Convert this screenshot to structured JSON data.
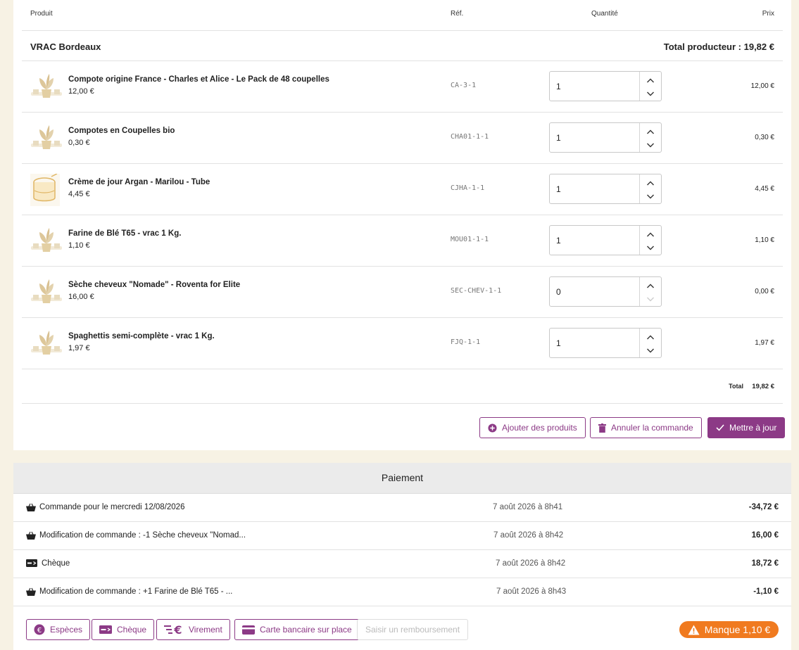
{
  "table": {
    "headers": {
      "product": "Produit",
      "ref": "Réf.",
      "qty": "Quantité",
      "price": "Prix"
    },
    "producer": {
      "name": "VRAC Bordeaux",
      "total": "Total producteur : 19,82 €"
    },
    "rows": [
      {
        "name": "Compote origine France - Charles et Alice - Le Pack de 48 coupelles",
        "unit_price": "12,00 €",
        "ref": "CA-3-1",
        "qty": "1",
        "line_price": "12,00 €",
        "thumb": "plant-icon"
      },
      {
        "name": "Compotes en Coupelles bio",
        "unit_price": "0,30 €",
        "ref": "CHA01-1-1",
        "qty": "1",
        "line_price": "0,30 €",
        "thumb": "plant-icon"
      },
      {
        "name": "Crème de jour Argan - Marilou - Tube",
        "unit_price": "4,45 €",
        "ref": "CJHA-1-1",
        "qty": "1",
        "line_price": "4,45 €",
        "thumb": "jar-icon"
      },
      {
        "name": "Farine de Blé T65 - vrac 1 Kg.",
        "unit_price": "1,10 €",
        "ref": "MOU01-1-1",
        "qty": "1",
        "line_price": "1,10 €",
        "thumb": "plant-icon"
      },
      {
        "name": "Sèche cheveux \"Nomade\" - Roventa for Elite",
        "unit_price": "16,00 €",
        "ref": "SEC-CHEV-1-1",
        "qty": "0",
        "line_price": "0,00 €",
        "thumb": "plant-icon"
      },
      {
        "name": "Spaghettis semi-complète - vrac 1 Kg.",
        "unit_price": "1,97 €",
        "ref": "FJQ-1-1",
        "qty": "1",
        "line_price": "1,97 €",
        "thumb": "plant-icon"
      }
    ],
    "total_label": "Total",
    "total_value": "19,82 €"
  },
  "actions": {
    "add_products": "Ajouter des produits",
    "cancel_order": "Annuler la commande",
    "update": "Mettre à jour"
  },
  "payment": {
    "title": "Paiement",
    "rows": [
      {
        "icon": "basket-icon",
        "label": "Commande pour le mercredi 12/08/2026",
        "date": "7 août 2026 à 8h41",
        "amount": "-34,72 €"
      },
      {
        "icon": "basket-icon",
        "label": "Modification de commande : -1 Sèche cheveux \"Nomad...",
        "date": "7 août 2026 à 8h42",
        "amount": "16,00 €"
      },
      {
        "icon": "cheque-icon",
        "label": "Chèque",
        "date": "7 août 2026 à 8h42",
        "amount": "18,72 €"
      },
      {
        "icon": "basket-icon",
        "label": "Modification de commande : +1 Farine de Blé T65 - ...",
        "date": "7 août 2026 à 8h43",
        "amount": "-1,10 €"
      }
    ],
    "methods": {
      "cash": "Espèces",
      "cheque": "Chèque",
      "transfer": "Virement",
      "card": "Carte bancaire sur place",
      "refund": "Saisir un remboursement"
    },
    "missing": "Manque 1,10 €"
  },
  "colors": {
    "accent": "#8c3a86",
    "warning": "#f07a1f",
    "background": "#f7f2e4"
  }
}
